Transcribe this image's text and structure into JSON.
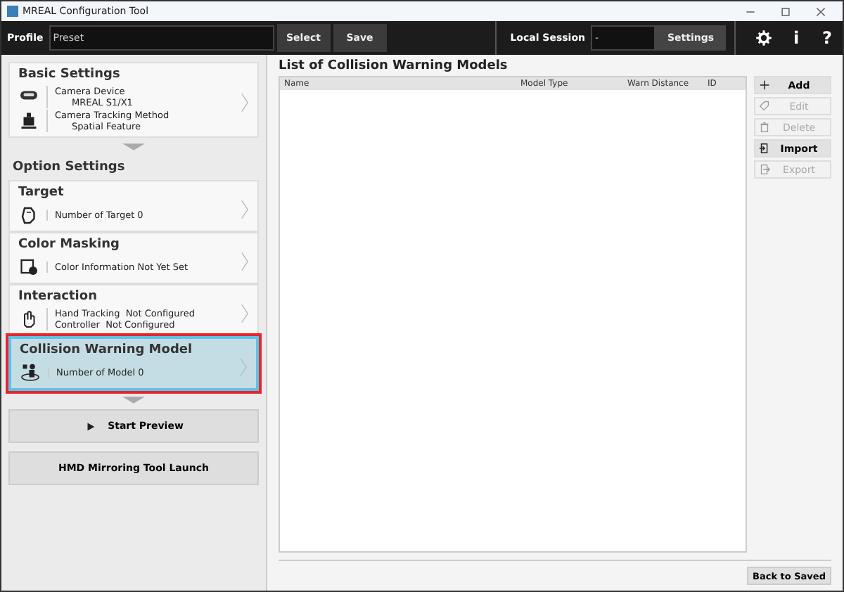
{
  "window": {
    "title": "MREAL Configuration Tool"
  },
  "toolbar": {
    "profile_label": "Profile",
    "profile_value": "Preset",
    "select": "Select",
    "save": "Save",
    "session_label": "Local Session",
    "session_value": "-",
    "settings": "Settings",
    "info": "i",
    "help": "?"
  },
  "basic_settings": {
    "title": "Basic Settings",
    "items": [
      {
        "label": "Camera Device",
        "value": "MREAL S1/X1"
      },
      {
        "label": "Camera Tracking Method",
        "value": "Spatial Feature"
      }
    ]
  },
  "option_settings": {
    "title": "Option Settings",
    "cards": [
      {
        "title": "Target",
        "lines": [
          "Number of Target 0"
        ],
        "selected": false
      },
      {
        "title": "Color Masking",
        "lines": [
          "Color Information Not Yet Set"
        ],
        "selected": false
      },
      {
        "title": "Interaction",
        "lines": [
          "Hand Tracking  Not Configured",
          "Controller  Not Configured"
        ],
        "selected": false
      },
      {
        "title": "Collision Warning Model",
        "lines": [
          "Number of Model 0"
        ],
        "selected": true
      }
    ]
  },
  "actions": [
    "Start Preview",
    "HMD Mirroring Tool Launch"
  ],
  "list": {
    "title": "List of Collision Warning Models",
    "columns": [
      "Name",
      "Model Type",
      "Warn Distance",
      "ID"
    ]
  },
  "side_buttons": [
    {
      "label": "Add",
      "disabled": false
    },
    {
      "label": "Edit",
      "disabled": true
    },
    {
      "label": "Delete",
      "disabled": true
    },
    {
      "label": "Import",
      "disabled": false
    },
    {
      "label": "Export",
      "disabled": true
    }
  ],
  "footer": {
    "back": "Back to Saved"
  }
}
